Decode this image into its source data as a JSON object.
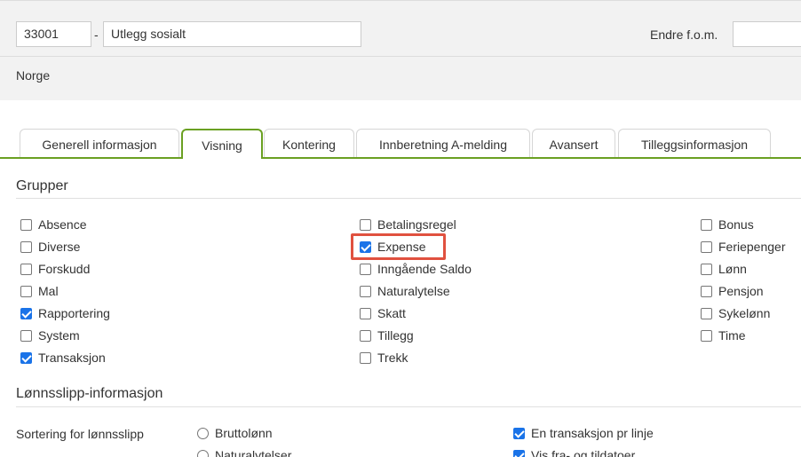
{
  "header": {
    "code": "33001",
    "separator": "-",
    "name": "Utlegg sosialt",
    "date_label": "Endre f.o.m.",
    "date_value": "",
    "country": "Norge"
  },
  "tabs": [
    {
      "label": "Generell informasjon",
      "active": false
    },
    {
      "label": "Visning",
      "active": true
    },
    {
      "label": "Kontering",
      "active": false
    },
    {
      "label": "Innberetning A-melding",
      "active": false
    },
    {
      "label": "Avansert",
      "active": false
    },
    {
      "label": "Tilleggsinformasjon",
      "active": false
    }
  ],
  "groups": {
    "title": "Grupper",
    "col1": [
      {
        "label": "Absence",
        "checked": false
      },
      {
        "label": "Diverse",
        "checked": false
      },
      {
        "label": "Forskudd",
        "checked": false
      },
      {
        "label": "Mal",
        "checked": false
      },
      {
        "label": "Rapportering",
        "checked": true
      },
      {
        "label": "System",
        "checked": false
      },
      {
        "label": "Transaksjon",
        "checked": true
      }
    ],
    "col2": [
      {
        "label": "Betalingsregel",
        "checked": false
      },
      {
        "label": "Expense",
        "checked": true
      },
      {
        "label": "Inngående Saldo",
        "checked": false
      },
      {
        "label": "Naturalytelse",
        "checked": false
      },
      {
        "label": "Skatt",
        "checked": false
      },
      {
        "label": "Tillegg",
        "checked": false
      },
      {
        "label": "Trekk",
        "checked": false
      }
    ],
    "col3": [
      {
        "label": "Bonus",
        "checked": false
      },
      {
        "label": "Feriepenger",
        "checked": false
      },
      {
        "label": "Lønn",
        "checked": false
      },
      {
        "label": "Pensjon",
        "checked": false
      },
      {
        "label": "Sykelønn",
        "checked": false
      },
      {
        "label": "Time",
        "checked": false
      }
    ]
  },
  "payslip": {
    "title": "Lønnsslipp-informasjon",
    "sort_label": "Sortering for lønnsslipp",
    "radios": [
      {
        "label": "Bruttolønn",
        "selected": false
      },
      {
        "label": "Naturalytelser",
        "selected": false
      }
    ],
    "options": [
      {
        "label": "En transaksjon pr linje",
        "checked": true
      },
      {
        "label": "Vis fra- og tildatoer",
        "checked": true
      }
    ]
  },
  "colors": {
    "accent": "#6aa022",
    "checkbox": "#1a73e8",
    "highlight": "#e0513f"
  }
}
